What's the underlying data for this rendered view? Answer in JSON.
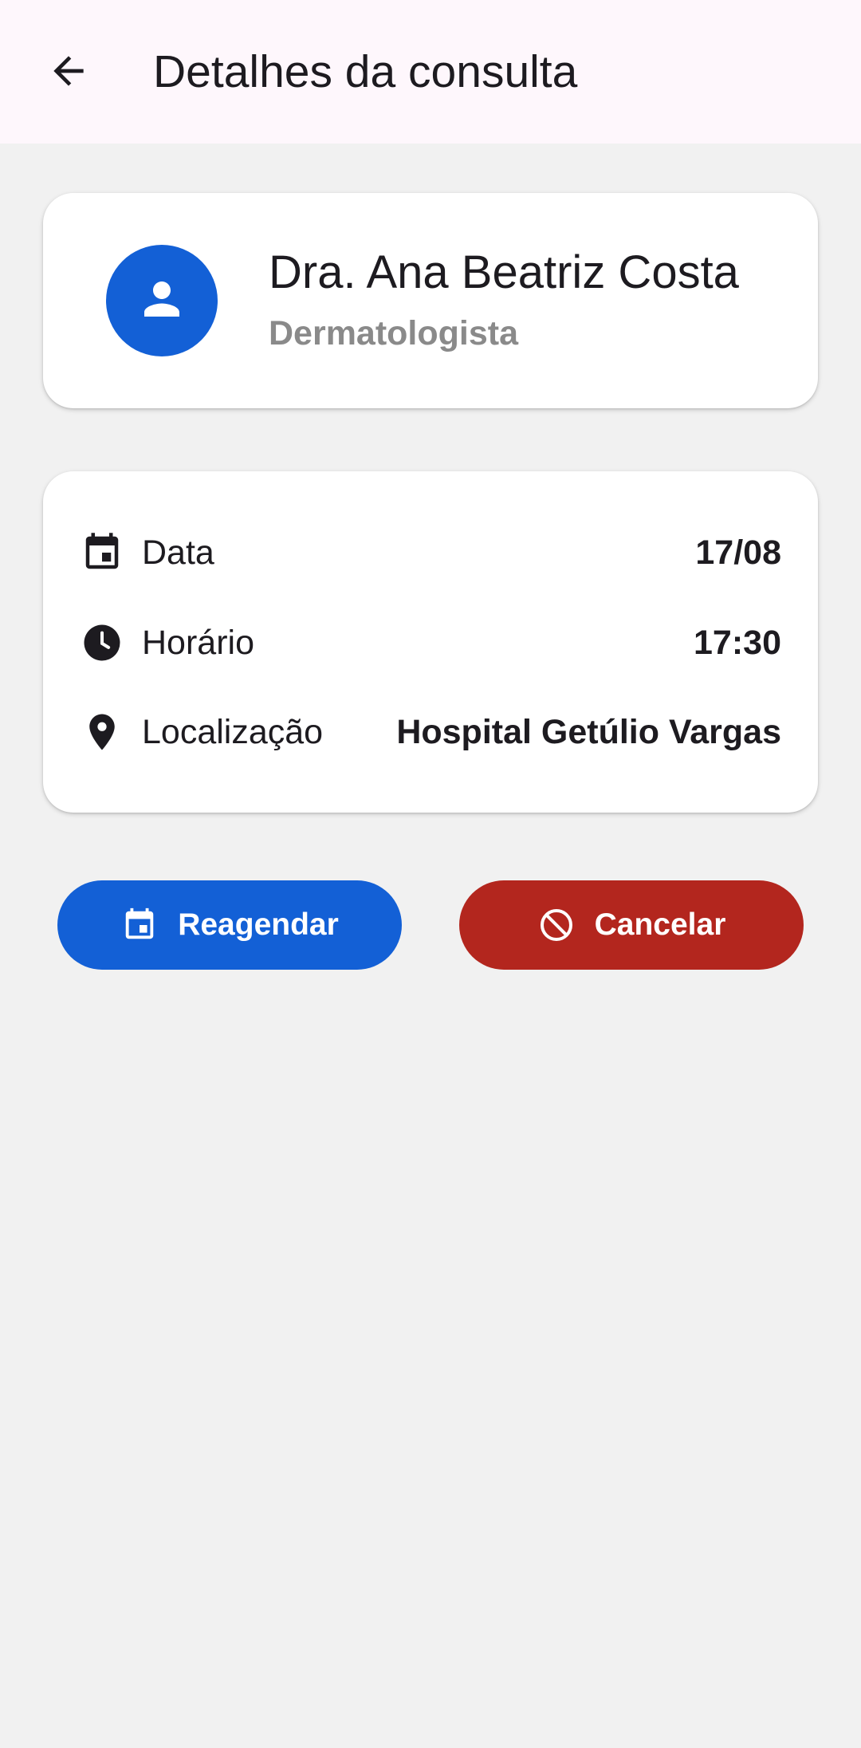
{
  "appbar": {
    "title": "Detalhes da consulta",
    "back_icon": "arrow-back-icon"
  },
  "doctor": {
    "name": "Dra. Ana Beatriz Costa",
    "specialty": "Dermatologista",
    "avatar_icon": "person-icon"
  },
  "details": {
    "date": {
      "label": "Data",
      "value": "17/08",
      "icon": "calendar-icon"
    },
    "time": {
      "label": "Horário",
      "value": "17:30",
      "icon": "clock-icon"
    },
    "location": {
      "label": "Localização",
      "value": "Hospital Getúlio Vargas",
      "icon": "location-pin-icon"
    }
  },
  "actions": {
    "reschedule": {
      "label": "Reagendar",
      "icon": "calendar-icon",
      "color": "#1360d6"
    },
    "cancel": {
      "label": "Cancelar",
      "icon": "block-icon",
      "color": "#b3261e"
    }
  },
  "colors": {
    "appbar_bg": "#fef7fc",
    "page_bg": "#f1f1f1",
    "accent": "#1360d6",
    "danger": "#b3261e"
  }
}
